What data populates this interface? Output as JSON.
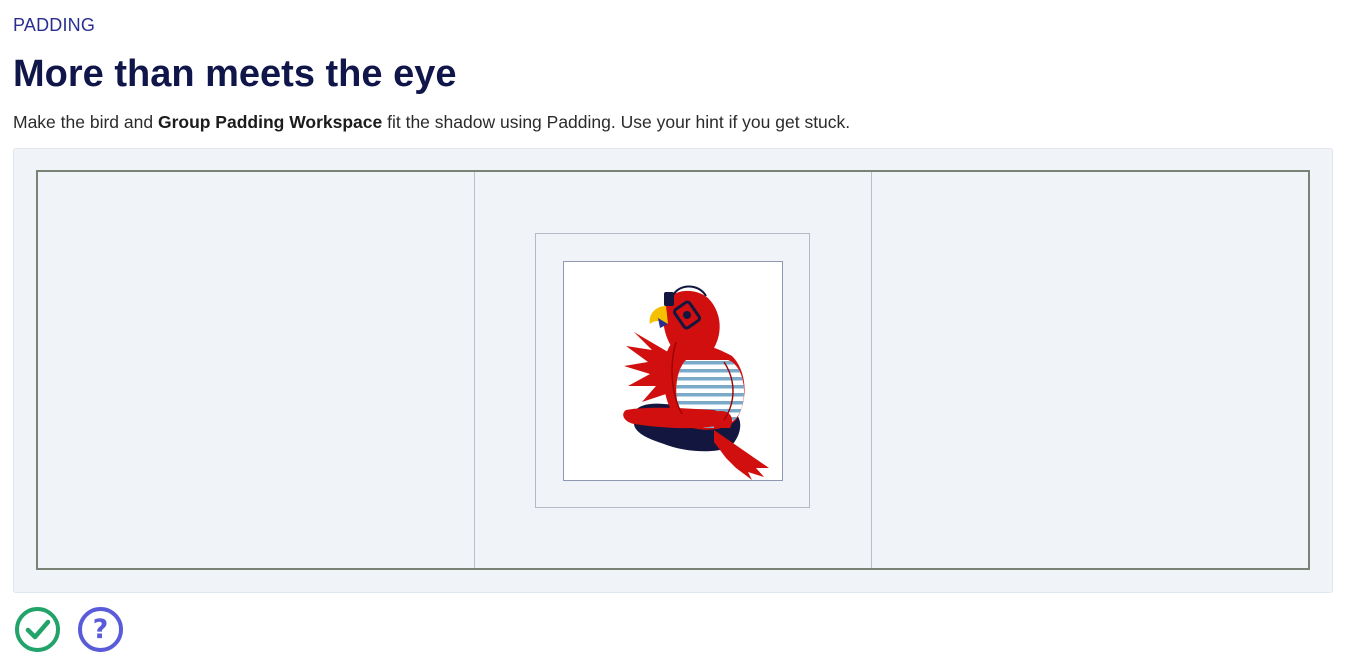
{
  "header": {
    "eyebrow": "PADDING",
    "title": "More than meets the eye",
    "description_prefix": "Make the bird and ",
    "description_bold": "Group Padding Workspace",
    "description_suffix": " fit the shadow using Padding. Use your hint if you get stuck."
  },
  "workspace": {
    "image_subject": "bird-with-headphones",
    "colors": {
      "bird_red": "#d10f0f",
      "beak_yellow": "#f5c000",
      "stripes_blue": "#7aa9c9",
      "rock_navy": "#13163f"
    }
  },
  "actions": {
    "check": {
      "icon": "check-circle-icon",
      "color": "#22a36a"
    },
    "hint": {
      "icon": "question-circle-icon",
      "glyph": "?",
      "color": "#5a5bd9"
    }
  }
}
